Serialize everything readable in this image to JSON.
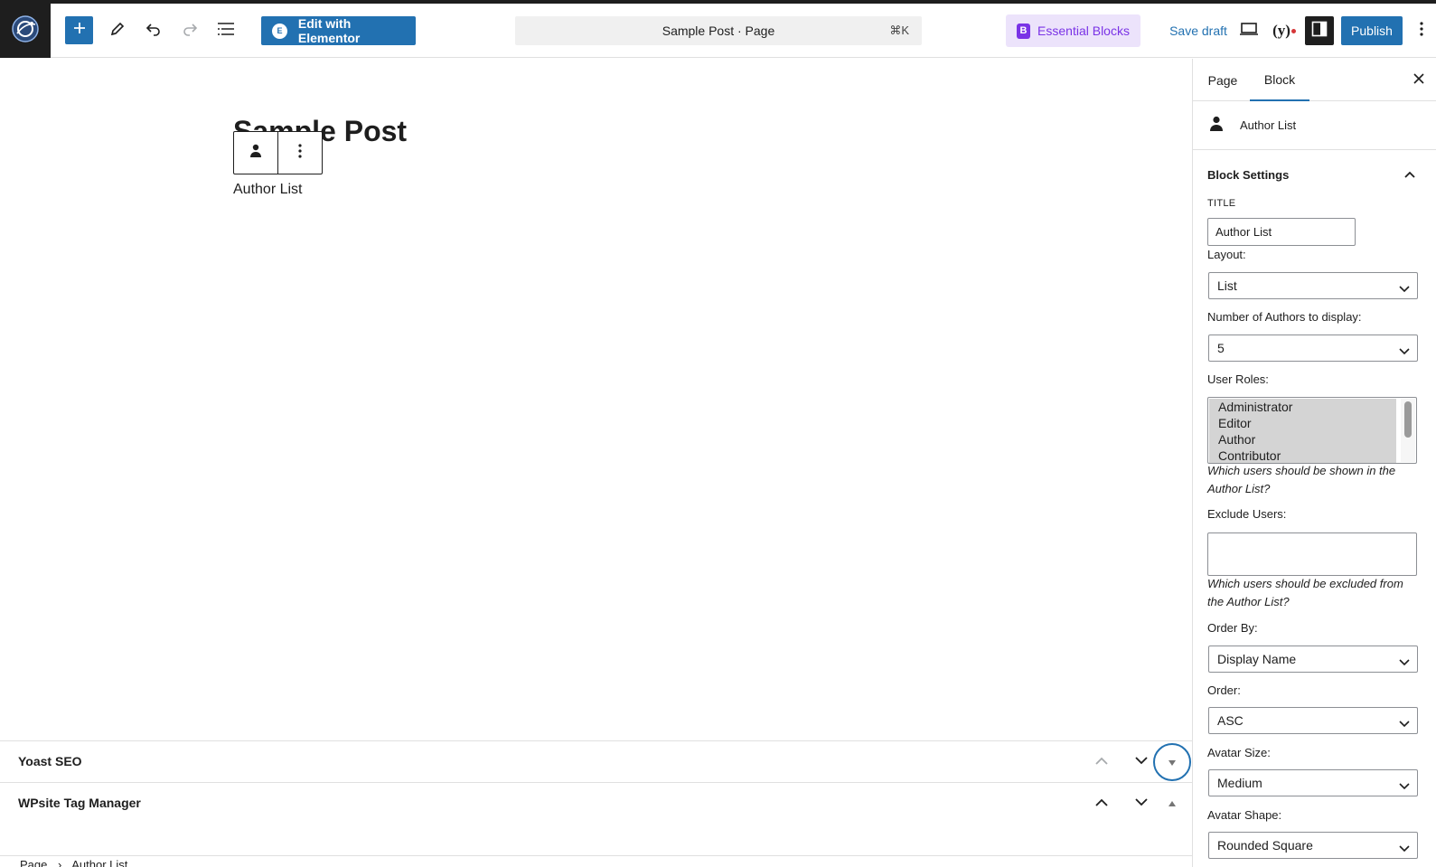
{
  "toolbar": {
    "edit_with_elementor": "Edit with Elementor",
    "command_title": "Sample Post · Page",
    "command_shortcut": "⌘K",
    "essential_blocks": "Essential Blocks",
    "save_draft": "Save draft",
    "yoast_label": "y",
    "publish": "Publish",
    "icons": [
      "wordpress-logo-icon",
      "plus-icon",
      "pencil-icon",
      "undo-icon",
      "redo-icon",
      "list-view-icon",
      "elementor-icon",
      "essential-blocks-icon",
      "desktop-preview-icon",
      "yoast-icon",
      "sidebar-toggle-icon",
      "more-vertical-icon"
    ],
    "accent_color": "#2271b1"
  },
  "editor": {
    "post_title": "Sample Post",
    "block_text": "Author List"
  },
  "metaboxes": {
    "yoast": "Yoast SEO",
    "tag_manager": "WPsite Tag Manager"
  },
  "breadcrumb": {
    "page": "Page",
    "current": "Author List"
  },
  "sidebar": {
    "tab_page": "Page",
    "tab_block": "Block",
    "block_name": "Author List",
    "panel_title": "Block Settings",
    "title_label": "TITLE",
    "title_value": "Author List",
    "layout_label": "Layout:",
    "layout_value": "List",
    "number_label": "Number of Authors to display:",
    "number_value": "5",
    "roles_label": "User Roles:",
    "roles": [
      "Administrator",
      "Editor",
      "Author",
      "Contributor"
    ],
    "roles_help": "Which users should be shown in the Author List?",
    "exclude_label": "Exclude Users:",
    "exclude_value": "",
    "exclude_help": "Which users should be excluded from the Author List?",
    "order_by_label": "Order By:",
    "order_by_value": "Display Name",
    "order_label": "Order:",
    "order_value": "ASC",
    "avatar_size_label": "Avatar Size:",
    "avatar_size_value": "Medium",
    "avatar_shape_label": "Avatar Shape:",
    "avatar_shape_value": "Rounded Square"
  }
}
